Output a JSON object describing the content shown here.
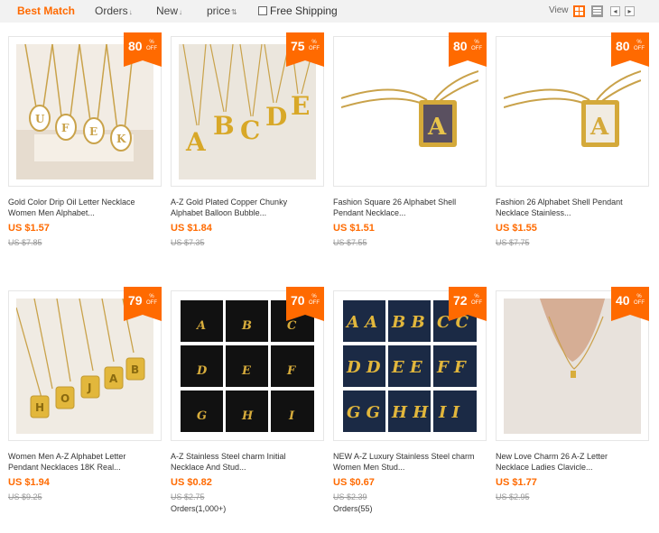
{
  "sort": {
    "best_match": "Best Match",
    "orders": "Orders",
    "new": "New",
    "price": "price",
    "free_shipping": "Free Shipping",
    "view": "View"
  },
  "colors": {
    "accent": "#ff6a00",
    "old_price": "#999999"
  },
  "icons": {
    "grid_view": "grid-view-icon",
    "list_view": "list-view-icon",
    "prev": "chevron-left-icon",
    "next": "chevron-right-icon"
  },
  "products": [
    {
      "discount": "80",
      "title_1": "Gold Color Drip Oil Letter Necklace",
      "title_2": "Women Men Alphabet...",
      "price": "US $1.57",
      "old_price": "US $7.85",
      "orders": ""
    },
    {
      "discount": "75",
      "title_1": "A-Z Gold Plated Copper Chunky",
      "title_2": "Alphabet Balloon Bubble...",
      "price": "US $1.84",
      "old_price": "US $7.35",
      "orders": ""
    },
    {
      "discount": "80",
      "title_1": "Fashion Square 26 Alphabet Shell",
      "title_2": "Pendant Necklace...",
      "price": "US $1.51",
      "old_price": "US $7.55",
      "orders": ""
    },
    {
      "discount": "80",
      "title_1": "Fashion 26 Alphabet Shell Pendant",
      "title_2": "Necklace Stainless...",
      "price": "US $1.55",
      "old_price": "US $7.75",
      "orders": ""
    },
    {
      "discount": "79",
      "title_1": "Women Men A-Z Alphabet Letter",
      "title_2": "Pendant Necklaces 18K Real...",
      "price": "US $1.94",
      "old_price": "US $9.25",
      "orders": ""
    },
    {
      "discount": "70",
      "title_1": "A-Z Stainless Steel charm Initial",
      "title_2": "Necklace And Stud...",
      "price": "US $0.82",
      "old_price": "US $2.75",
      "orders": "Orders(1,000+)"
    },
    {
      "discount": "72",
      "title_1": "NEW A-Z Luxury Stainless Steel charm",
      "title_2": "Women Men Stud...",
      "price": "US $0.67",
      "old_price": "US $2.39",
      "orders": "Orders(55)"
    },
    {
      "discount": "40",
      "title_1": "New Love Charm 26 A-Z Letter",
      "title_2": "Necklace Ladies Clavicle...",
      "price": "US $1.77",
      "old_price": "US $2.95",
      "orders": ""
    }
  ],
  "off_label": "OFF",
  "percent_sign": "%"
}
